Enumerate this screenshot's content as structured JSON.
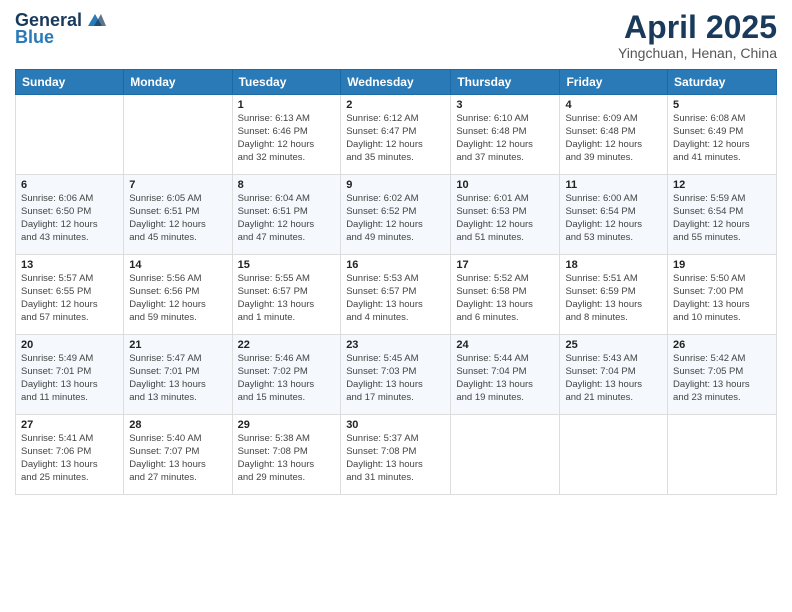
{
  "header": {
    "logo_general": "General",
    "logo_blue": "Blue",
    "month_title": "April 2025",
    "location": "Yingchuan, Henan, China"
  },
  "columns": [
    "Sunday",
    "Monday",
    "Tuesday",
    "Wednesday",
    "Thursday",
    "Friday",
    "Saturday"
  ],
  "weeks": [
    [
      {
        "day": "",
        "info": ""
      },
      {
        "day": "",
        "info": ""
      },
      {
        "day": "1",
        "info": "Sunrise: 6:13 AM\nSunset: 6:46 PM\nDaylight: 12 hours\nand 32 minutes."
      },
      {
        "day": "2",
        "info": "Sunrise: 6:12 AM\nSunset: 6:47 PM\nDaylight: 12 hours\nand 35 minutes."
      },
      {
        "day": "3",
        "info": "Sunrise: 6:10 AM\nSunset: 6:48 PM\nDaylight: 12 hours\nand 37 minutes."
      },
      {
        "day": "4",
        "info": "Sunrise: 6:09 AM\nSunset: 6:48 PM\nDaylight: 12 hours\nand 39 minutes."
      },
      {
        "day": "5",
        "info": "Sunrise: 6:08 AM\nSunset: 6:49 PM\nDaylight: 12 hours\nand 41 minutes."
      }
    ],
    [
      {
        "day": "6",
        "info": "Sunrise: 6:06 AM\nSunset: 6:50 PM\nDaylight: 12 hours\nand 43 minutes."
      },
      {
        "day": "7",
        "info": "Sunrise: 6:05 AM\nSunset: 6:51 PM\nDaylight: 12 hours\nand 45 minutes."
      },
      {
        "day": "8",
        "info": "Sunrise: 6:04 AM\nSunset: 6:51 PM\nDaylight: 12 hours\nand 47 minutes."
      },
      {
        "day": "9",
        "info": "Sunrise: 6:02 AM\nSunset: 6:52 PM\nDaylight: 12 hours\nand 49 minutes."
      },
      {
        "day": "10",
        "info": "Sunrise: 6:01 AM\nSunset: 6:53 PM\nDaylight: 12 hours\nand 51 minutes."
      },
      {
        "day": "11",
        "info": "Sunrise: 6:00 AM\nSunset: 6:54 PM\nDaylight: 12 hours\nand 53 minutes."
      },
      {
        "day": "12",
        "info": "Sunrise: 5:59 AM\nSunset: 6:54 PM\nDaylight: 12 hours\nand 55 minutes."
      }
    ],
    [
      {
        "day": "13",
        "info": "Sunrise: 5:57 AM\nSunset: 6:55 PM\nDaylight: 12 hours\nand 57 minutes."
      },
      {
        "day": "14",
        "info": "Sunrise: 5:56 AM\nSunset: 6:56 PM\nDaylight: 12 hours\nand 59 minutes."
      },
      {
        "day": "15",
        "info": "Sunrise: 5:55 AM\nSunset: 6:57 PM\nDaylight: 13 hours\nand 1 minute."
      },
      {
        "day": "16",
        "info": "Sunrise: 5:53 AM\nSunset: 6:57 PM\nDaylight: 13 hours\nand 4 minutes."
      },
      {
        "day": "17",
        "info": "Sunrise: 5:52 AM\nSunset: 6:58 PM\nDaylight: 13 hours\nand 6 minutes."
      },
      {
        "day": "18",
        "info": "Sunrise: 5:51 AM\nSunset: 6:59 PM\nDaylight: 13 hours\nand 8 minutes."
      },
      {
        "day": "19",
        "info": "Sunrise: 5:50 AM\nSunset: 7:00 PM\nDaylight: 13 hours\nand 10 minutes."
      }
    ],
    [
      {
        "day": "20",
        "info": "Sunrise: 5:49 AM\nSunset: 7:01 PM\nDaylight: 13 hours\nand 11 minutes."
      },
      {
        "day": "21",
        "info": "Sunrise: 5:47 AM\nSunset: 7:01 PM\nDaylight: 13 hours\nand 13 minutes."
      },
      {
        "day": "22",
        "info": "Sunrise: 5:46 AM\nSunset: 7:02 PM\nDaylight: 13 hours\nand 15 minutes."
      },
      {
        "day": "23",
        "info": "Sunrise: 5:45 AM\nSunset: 7:03 PM\nDaylight: 13 hours\nand 17 minutes."
      },
      {
        "day": "24",
        "info": "Sunrise: 5:44 AM\nSunset: 7:04 PM\nDaylight: 13 hours\nand 19 minutes."
      },
      {
        "day": "25",
        "info": "Sunrise: 5:43 AM\nSunset: 7:04 PM\nDaylight: 13 hours\nand 21 minutes."
      },
      {
        "day": "26",
        "info": "Sunrise: 5:42 AM\nSunset: 7:05 PM\nDaylight: 13 hours\nand 23 minutes."
      }
    ],
    [
      {
        "day": "27",
        "info": "Sunrise: 5:41 AM\nSunset: 7:06 PM\nDaylight: 13 hours\nand 25 minutes."
      },
      {
        "day": "28",
        "info": "Sunrise: 5:40 AM\nSunset: 7:07 PM\nDaylight: 13 hours\nand 27 minutes."
      },
      {
        "day": "29",
        "info": "Sunrise: 5:38 AM\nSunset: 7:08 PM\nDaylight: 13 hours\nand 29 minutes."
      },
      {
        "day": "30",
        "info": "Sunrise: 5:37 AM\nSunset: 7:08 PM\nDaylight: 13 hours\nand 31 minutes."
      },
      {
        "day": "",
        "info": ""
      },
      {
        "day": "",
        "info": ""
      },
      {
        "day": "",
        "info": ""
      }
    ]
  ]
}
